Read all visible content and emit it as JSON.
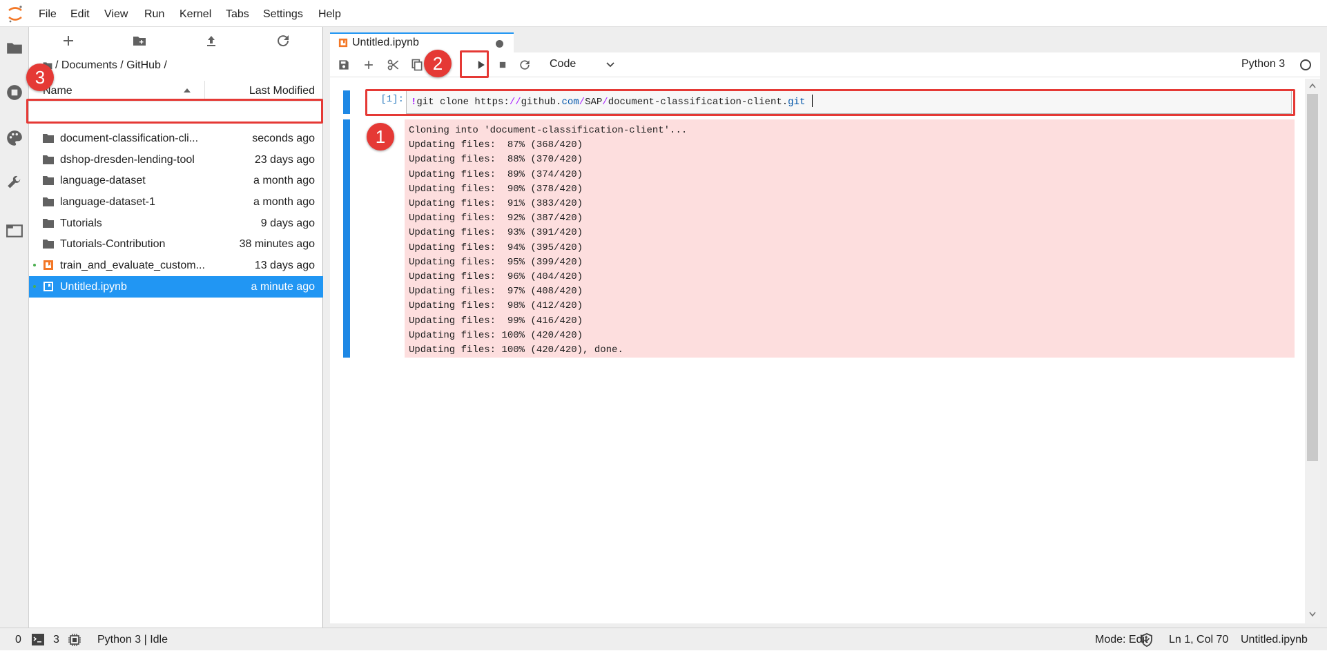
{
  "menubar": {
    "items": [
      "File",
      "Edit",
      "View",
      "Run",
      "Kernel",
      "Tabs",
      "Settings",
      "Help"
    ]
  },
  "filebrowser": {
    "breadcrumbs": "/ Documents / GitHub /",
    "col_name": "Name",
    "col_modified": "Last Modified",
    "rows": [
      {
        "name": "document-classification-cli...",
        "modified": "seconds ago",
        "type": "folder"
      },
      {
        "name": "dshop-dresden-lending-tool",
        "modified": "23 days ago",
        "type": "folder"
      },
      {
        "name": "language-dataset",
        "modified": "a month ago",
        "type": "folder"
      },
      {
        "name": "language-dataset-1",
        "modified": "a month ago",
        "type": "folder"
      },
      {
        "name": "Tutorials",
        "modified": "9 days ago",
        "type": "folder"
      },
      {
        "name": "Tutorials-Contribution",
        "modified": "38 minutes ago",
        "type": "folder"
      },
      {
        "name": "train_and_evaluate_custom...",
        "modified": "13 days ago",
        "type": "notebook"
      },
      {
        "name": "Untitled.ipynb",
        "modified": "a minute ago",
        "type": "notebook"
      }
    ]
  },
  "notebook": {
    "tab_title": "Untitled.ipynb",
    "cell_type": "Code",
    "kernel_name": "Python 3",
    "prompt": "[1]:",
    "code_bang": "!",
    "code_cmd": "git clone https:",
    "code_slashes": "//",
    "code_host": "github.",
    "code_com": "com",
    "code_slash1": "/",
    "code_sap": "SAP",
    "code_slash2": "/",
    "code_repo": "document-classification-client.",
    "code_git": "git",
    "output_lines": [
      "Cloning into 'document-classification-client'...",
      "Updating files:  87% (368/420)",
      "Updating files:  88% (370/420)",
      "Updating files:  89% (374/420)",
      "Updating files:  90% (378/420)",
      "Updating files:  91% (383/420)",
      "Updating files:  92% (387/420)",
      "Updating files:  93% (391/420)",
      "Updating files:  94% (395/420)",
      "Updating files:  95% (399/420)",
      "Updating files:  96% (404/420)",
      "Updating files:  97% (408/420)",
      "Updating files:  98% (412/420)",
      "Updating files:  99% (416/420)",
      "Updating files: 100% (420/420)",
      "Updating files: 100% (420/420), done."
    ]
  },
  "statusbar": {
    "count_a": "0",
    "count_b": "3",
    "kernel_status": "Python 3 | Idle",
    "mode": "Mode: Edit",
    "cursor": "Ln 1, Col 70",
    "filename": "Untitled.ipynb"
  },
  "annotations": [
    "1",
    "2",
    "3"
  ],
  "colors": {
    "accent": "#2196f3",
    "annotation": "#e53935",
    "output_bg": "#fddede"
  }
}
